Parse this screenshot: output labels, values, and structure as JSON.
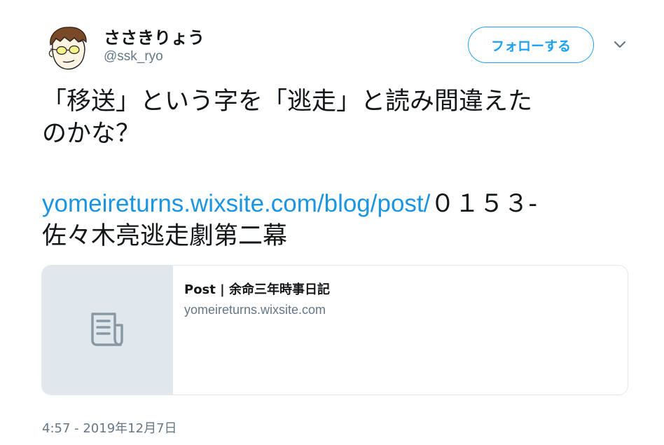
{
  "tweet": {
    "author": {
      "display_name": "ささきりょう",
      "handle": "@ssk_ryo"
    },
    "follow_label": "フォローする",
    "text": {
      "line1": "「移送」という字を「逃走」と読み間違えた",
      "line2": "のかな？",
      "link": "yomeireturns.wixsite.com/blog/post/",
      "link_suffix": "０１５３-",
      "line4": "佐々木亮逃走劇第二幕"
    },
    "card": {
      "title": "Post | 余命三年時事日記",
      "domain": "yomeireturns.wixsite.com",
      "thumb_icon": "document-icon"
    },
    "timestamp": "4:57 - 2019年12月7日"
  },
  "colors": {
    "accent": "#1da1f2",
    "link": "#1b95e0",
    "muted": "#657786",
    "border": "#e1e8ed"
  }
}
